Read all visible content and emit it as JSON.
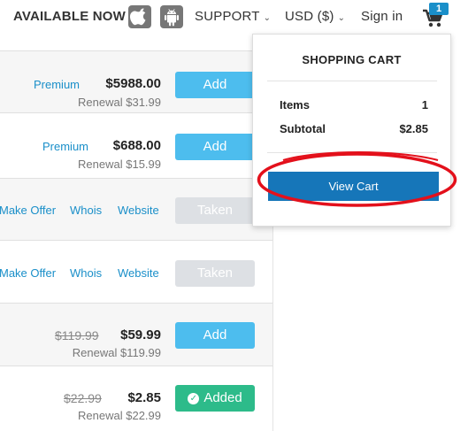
{
  "header": {
    "available_now": "AVAILABLE NOW",
    "support": "SUPPORT",
    "currency": "USD ($)",
    "sign_in": "Sign in",
    "cart_count": "1"
  },
  "rows": [
    {
      "premium": "Premium",
      "price": "$5988.00",
      "renewal": "Renewal $31.99",
      "button": "Add"
    },
    {
      "premium": "Premium",
      "price": "$688.00",
      "renewal": "Renewal $15.99",
      "button": "Add"
    },
    {
      "make_offer": "Make Offer",
      "whois": "Whois",
      "website": "Website",
      "button": "Taken"
    },
    {
      "make_offer": "Make Offer",
      "whois": "Whois",
      "website": "Website",
      "button": "Taken"
    },
    {
      "old_price": "$119.99",
      "price": "$59.99",
      "renewal": "Renewal $119.99",
      "button": "Add"
    },
    {
      "old_price": "$22.99",
      "price": "$2.85",
      "renewal": "Renewal $22.99",
      "button": "Added"
    }
  ],
  "cart": {
    "title": "SHOPPING CART",
    "items_label": "Items",
    "items_value": "1",
    "subtotal_label": "Subtotal",
    "subtotal_value": "$2.85",
    "view_cart": "View Cart"
  },
  "colors": {
    "link_blue": "#1a8fc9",
    "add_button": "#4dbdee",
    "added_button": "#2dbb8a",
    "view_cart_button": "#1676b9",
    "highlight_red": "#e3101b"
  }
}
